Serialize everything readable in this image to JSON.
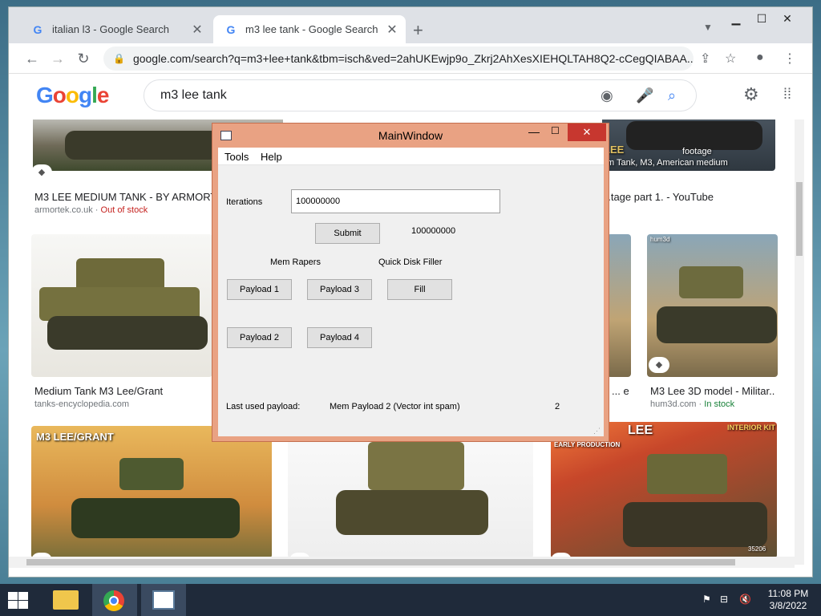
{
  "browser": {
    "tabs": [
      {
        "label": "italian l3 - Google Search"
      },
      {
        "label": "m3 lee tank - Google Search"
      }
    ],
    "url": "google.com/search?q=m3+lee+tank&tbm=isch&ved=2ahUKEwjp9o_Zkrj2AhXesXIEHQLTAH8Q2-cCegQIABAA..."
  },
  "google": {
    "logo": "Google",
    "query": "m3 lee tank"
  },
  "results": [
    {
      "title": "M3 LEE MEDIUM TANK - BY ARMORTEK",
      "source": "armortek.co.uk",
      "status": "Out of stock"
    },
    {
      "title": "...tage part 1. - YouTube",
      "source": ""
    },
    {
      "title": "Medium Tank M3 Lee/Grant",
      "source": "tanks-encyclopedia.com"
    },
    {
      "title": "... e a...",
      "source": ""
    },
    {
      "title": "M3 Lee 3D model - Militar...",
      "source": "hum3d.com",
      "status": "In stock"
    }
  ],
  "thumb_text": {
    "lee_footage": "LEE",
    "footage_caption": "footage",
    "footage_subcaption": "m Tank, M3, American medium",
    "lee_grant": "M3 LEE/GRANT",
    "kit_title": "LEE",
    "kit_subtitle": "EARLY PRODUCTION",
    "kit_brand": "INTERIOR KIT",
    "kit_number": "35206",
    "hum3d_label": "hum3d"
  },
  "mainwindow": {
    "title": "MainWindow",
    "menu": {
      "tools": "Tools",
      "help": "Help"
    },
    "iterations_label": "Iterations",
    "iterations_value": "100000000",
    "submit_label": "Submit",
    "submitted_value": "100000000",
    "mem_rapers_label": "Mem Rapers",
    "quick_disk_filler_label": "Quick Disk Filler",
    "payload1": "Payload 1",
    "payload2": "Payload 2",
    "payload3": "Payload 3",
    "payload4": "Payload 4",
    "fill": "Fill",
    "last_used_label": "Last used payload:",
    "last_used_value": "Mem Payload 2 (Vector int spam)",
    "last_used_count": "2"
  },
  "taskbar": {
    "time": "11:08 PM",
    "date": "3/8/2022"
  }
}
